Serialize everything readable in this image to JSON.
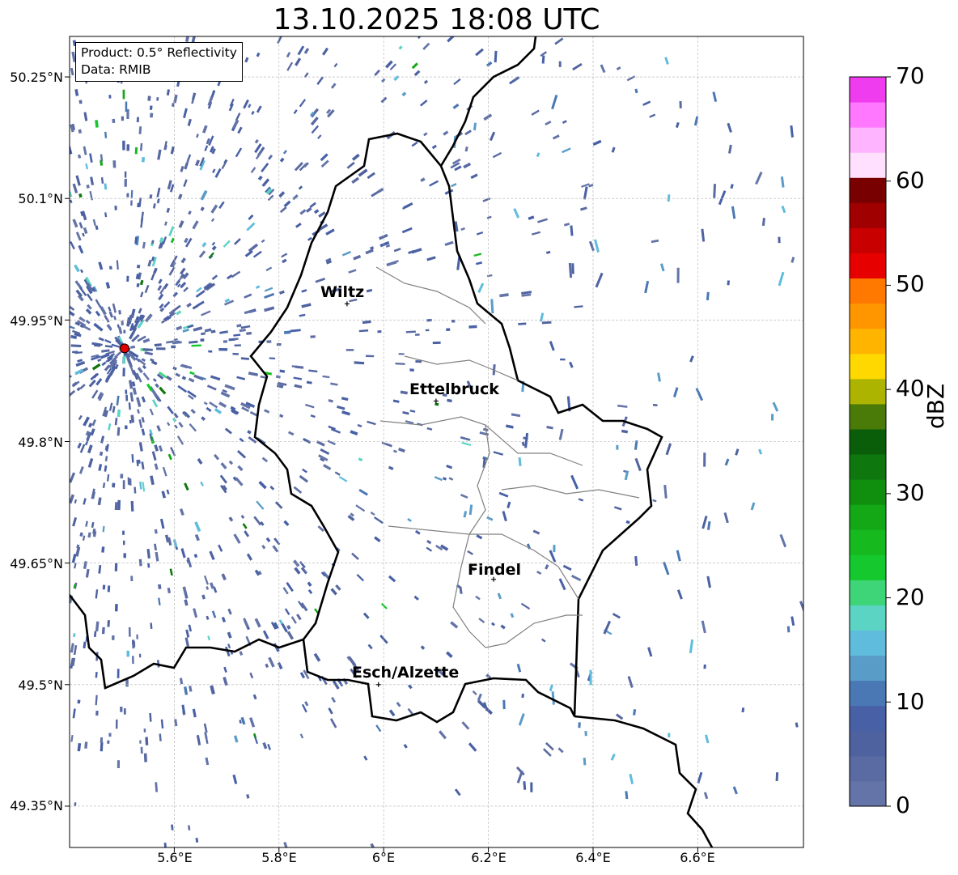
{
  "title": "13.10.2025 18:08 UTC",
  "info": {
    "product": "Product: 0.5° Reflectivity",
    "source": "Data: RMIB"
  },
  "axes": {
    "lat_ticks": [
      "50.25°N",
      "50.1°N",
      "49.95°N",
      "49.8°N",
      "49.65°N",
      "49.5°N",
      "49.35°N"
    ],
    "lon_ticks": [
      "5.6°E",
      "5.8°E",
      "6°E",
      "6.2°E",
      "6.4°E",
      "6.6°E"
    ],
    "lon_range": [
      5.4,
      6.8
    ],
    "lat_range": [
      49.3,
      50.3
    ]
  },
  "cities": [
    {
      "name": "Wiltz",
      "lon": 5.93,
      "lat": 49.97
    },
    {
      "name": "Ettelbruck",
      "lon": 6.1,
      "lat": 49.85
    },
    {
      "name": "Findel",
      "lon": 6.21,
      "lat": 49.63
    },
    {
      "name": "Esch/Alzette",
      "lon": 5.99,
      "lat": 49.5
    }
  ],
  "radar_site": {
    "lon": 5.505,
    "lat": 49.915
  },
  "colorbar": {
    "label": "dBZ",
    "ticks": [
      "0",
      "10",
      "20",
      "30",
      "40",
      "50",
      "60",
      "70"
    ],
    "min": 0,
    "max": 70,
    "colors": [
      "#6474a8",
      "#5a6aa2",
      "#4e62a0",
      "#4860a6",
      "#4a78b4",
      "#5a9cc8",
      "#60bcdc",
      "#5cd4c4",
      "#3ed478",
      "#14c82e",
      "#16ba1e",
      "#14a816",
      "#108e0e",
      "#0e780e",
      "#0a5e0a",
      "#4a7a08",
      "#acb400",
      "#ffd800",
      "#ffb400",
      "#ff9600",
      "#ff7800",
      "#e60000",
      "#c80000",
      "#a00000",
      "#780000",
      "#ffe0ff",
      "#ffb4ff",
      "#ff78ff",
      "#ee3cee"
    ]
  }
}
